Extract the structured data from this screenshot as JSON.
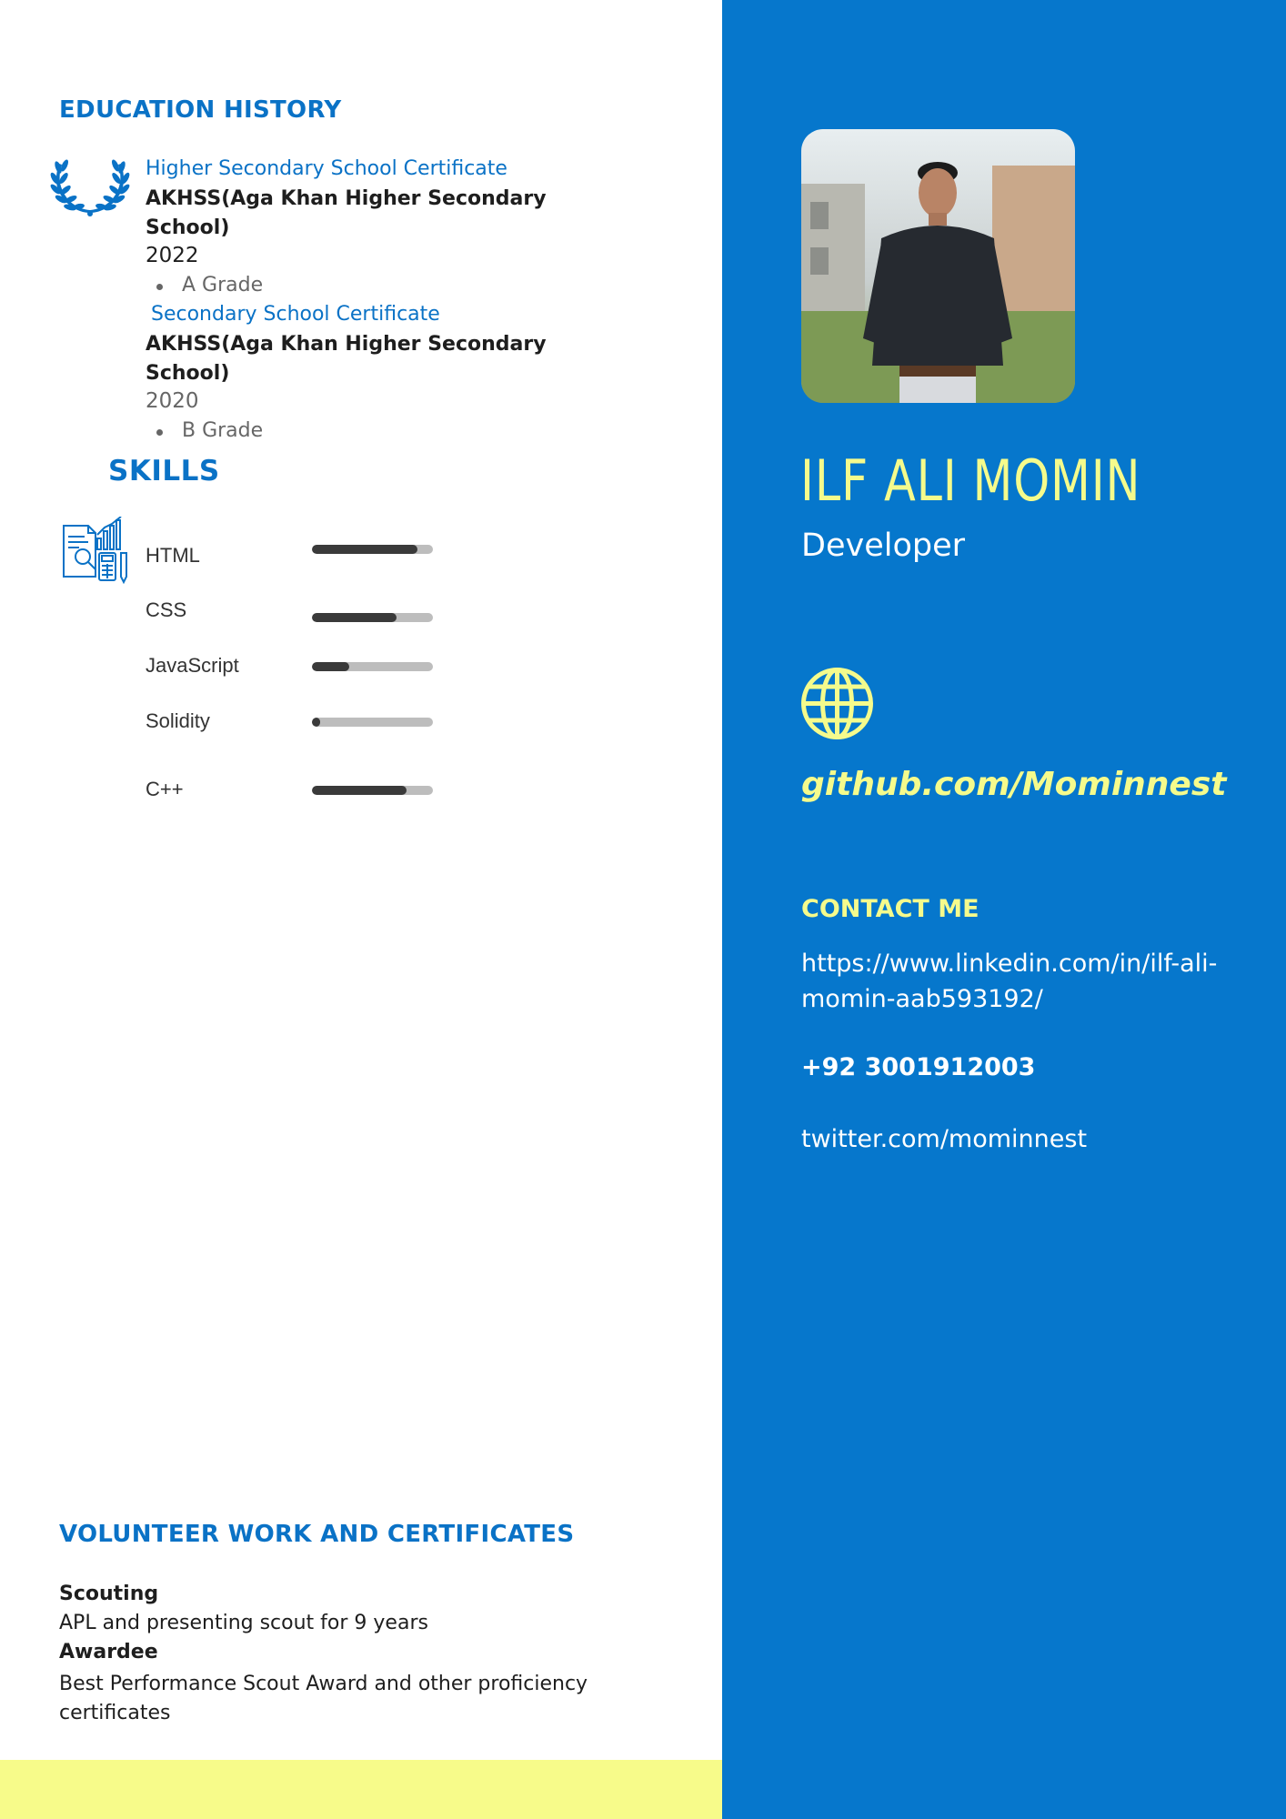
{
  "education": {
    "title": "EDUCATION HISTORY",
    "entries": [
      {
        "certificate": "Higher Secondary School Certificate",
        "school": "AKHSS(Aga Khan Higher Secondary School)",
        "year": "2022",
        "grade": "A Grade"
      },
      {
        "certificate": "Secondary School Certificate",
        "school": "AKHSS(Aga Khan Higher Secondary School)",
        "year": "2020",
        "grade": "B Grade"
      }
    ]
  },
  "skills": {
    "title": "SKILLS",
    "items": [
      {
        "label": "HTML",
        "level": 0.87
      },
      {
        "label": "CSS",
        "level": 0.7
      },
      {
        "label": "JavaScript",
        "level": 0.31
      },
      {
        "label": "Solidity",
        "level": 0.07
      },
      {
        "label": "C++",
        "level": 0.78
      }
    ]
  },
  "volunteer": {
    "title": "VOLUNTEER WORK AND CERTIFICATES",
    "items": [
      {
        "heading": "Scouting",
        "text": "APL and presenting scout for 9 years"
      },
      {
        "heading": "Awardee",
        "text": "Best Performance Scout Award and other proficiency certificates"
      }
    ]
  },
  "profile": {
    "name": "ILF ALI MOMIN",
    "role": "Developer",
    "github": "github.com/Mominnest"
  },
  "contact": {
    "title": "CONTACT ME",
    "linkedin": "https://www.linkedin.com/in/ilf-ali-momin-aab593192/",
    "phone": "+92 3001912003",
    "twitter": "twitter.com/mominnest"
  },
  "icons": {
    "laurel": "laurel-wreath-icon",
    "skills": "analytics-document-icon",
    "globe": "globe-icon"
  },
  "colors": {
    "accent_blue": "#0677cc",
    "heading_blue": "#0a72c6",
    "highlight_yellow": "#f5fb8c",
    "band_yellow": "#f7fb8a",
    "bar_fill": "#3a3a3a",
    "bar_track": "#bdbdbd"
  }
}
